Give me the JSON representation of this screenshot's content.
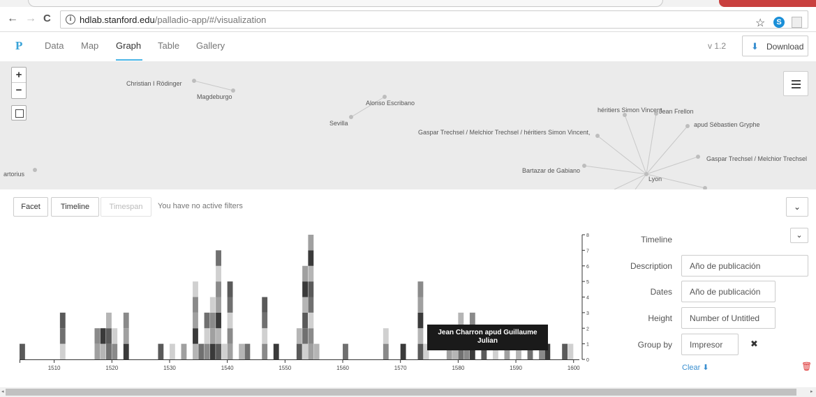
{
  "browser": {
    "back_icon": "arrow-left-icon",
    "forward_icon": "arrow-right-icon",
    "reload_icon": "reload-icon",
    "url_host": "hdlab.stanford.edu",
    "url_path": "/palladio-app/#/visualization",
    "back_glyph": "←",
    "forward_glyph": "→",
    "reload_glyph": "C",
    "info_glyph": "i",
    "star_glyph": "☆",
    "skype_glyph": "S"
  },
  "app": {
    "logo": "P",
    "nav": [
      "Data",
      "Map",
      "Graph",
      "Table",
      "Gallery"
    ],
    "active_nav": "Graph",
    "version": "v 1.2",
    "download_label": "Download",
    "download_glyph": "⬇",
    "accent": "#4bb5e6"
  },
  "graph": {
    "zoom_in": "+",
    "zoom_out": "−",
    "nodes": [
      {
        "label": "Christian I Rödinger"
      },
      {
        "label": "Magdeburgo"
      },
      {
        "label": "Alonso Escribano"
      },
      {
        "label": "Sevilla"
      },
      {
        "label": "héritiers Simon Vincent"
      },
      {
        "label": "Jean Frellon"
      },
      {
        "label": "apud Sébastien Gryphe"
      },
      {
        "label": "Gaspar Trechsel / Melchior Trechsel / héritiers Simon Vincent,"
      },
      {
        "label": "Gaspar Trechsel / Melchior Trechsel"
      },
      {
        "label": "Bartazar de Gabiano"
      },
      {
        "label": "Lyon"
      },
      {
        "label": "artorius"
      }
    ]
  },
  "filters": {
    "facet": "Facet",
    "timeline": "Timeline",
    "timespan": "Timespan",
    "message": "You have no active filters",
    "collapse_glyph": "⌄"
  },
  "timeline_chart": {
    "tooltip": "Jean Charron apud Guillaume Julian",
    "highlight_color": "#5bc8e0"
  },
  "chart_data": {
    "type": "bar",
    "title": "",
    "xlabel": "",
    "ylabel": "",
    "xlim": [
      1504,
      1601
    ],
    "ylim": [
      0,
      8
    ],
    "x_ticks": [
      1510,
      1520,
      1530,
      1540,
      1550,
      1560,
      1570,
      1580,
      1590,
      1600
    ],
    "y_ticks": [
      0,
      1,
      2,
      3,
      4,
      5,
      6,
      7,
      8
    ],
    "x": [
      1504,
      1511,
      1517,
      1518,
      1519,
      1520,
      1522,
      1528,
      1530,
      1532,
      1534,
      1535,
      1536,
      1537,
      1538,
      1539,
      1540,
      1542,
      1543,
      1546,
      1548,
      1552,
      1553,
      1554,
      1555,
      1560,
      1567,
      1570,
      1573,
      1574,
      1578,
      1579,
      1580,
      1581,
      1582,
      1584,
      1586,
      1588,
      1590,
      1592,
      1594,
      1595,
      1598,
      1599
    ],
    "values": [
      1,
      3,
      2,
      2,
      3,
      2,
      3,
      1,
      1,
      1,
      5,
      1,
      3,
      4,
      7,
      1,
      5,
      1,
      1,
      4,
      1,
      2,
      6,
      8,
      1,
      1,
      2,
      1,
      5,
      1,
      1,
      1,
      3,
      1,
      3,
      1,
      1,
      1,
      1,
      1,
      1,
      1,
      1,
      1
    ],
    "highlight": {
      "x": 1574,
      "from": 2,
      "to": 3
    }
  },
  "settings": {
    "collapse_glyph": "⌄",
    "title": "Timeline",
    "description_label": "Description",
    "description_value": "Año de publicación",
    "dates_label": "Dates",
    "dates_value": "Año de publicación",
    "height_label": "Height",
    "height_value": "Number of Untitled",
    "groupby_label": "Group by",
    "groupby_value": "Impresor",
    "remove_glyph": "✖",
    "clear_label": "Clear",
    "clear_glyph": "⬇",
    "trash_glyph": "🗑"
  },
  "scrollbar": {
    "left_glyph": "◂",
    "right_glyph": "▸"
  }
}
